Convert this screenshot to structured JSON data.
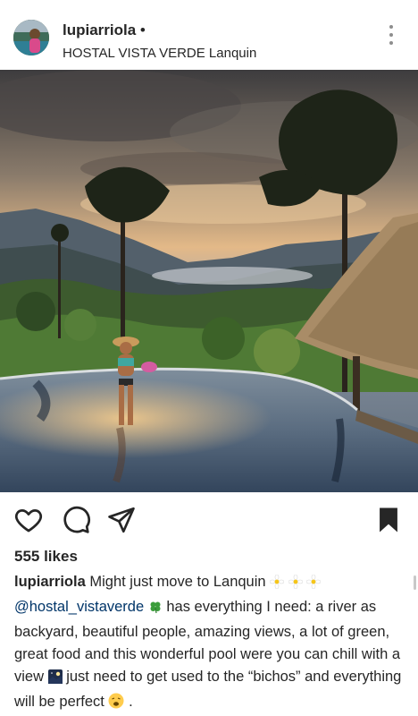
{
  "post": {
    "username": "lupiarriola",
    "follow_dot": "•",
    "location": "HOSTAL VISTA VERDE Lanquin",
    "likes": "555 likes"
  },
  "caption": {
    "username": "lupiarriola",
    "text1": "Might just move to Lanquin",
    "mention": "@hostal_vistaverde",
    "text2": "has everything I need: a river as backyard, beautiful people, amazing views, a lot of green, great food and this wonderful pool were you can chill with a view",
    "text3": "just need to get used to the “bichos” and everything will be perfect",
    "text4": "."
  },
  "icons": {
    "more": "more-options-icon",
    "like": "heart-icon",
    "comment": "comment-icon",
    "share": "share-icon",
    "save": "bookmark-icon"
  },
  "colors": {
    "text": "#262626",
    "mention": "#003569",
    "muted": "#8e8e8e"
  }
}
